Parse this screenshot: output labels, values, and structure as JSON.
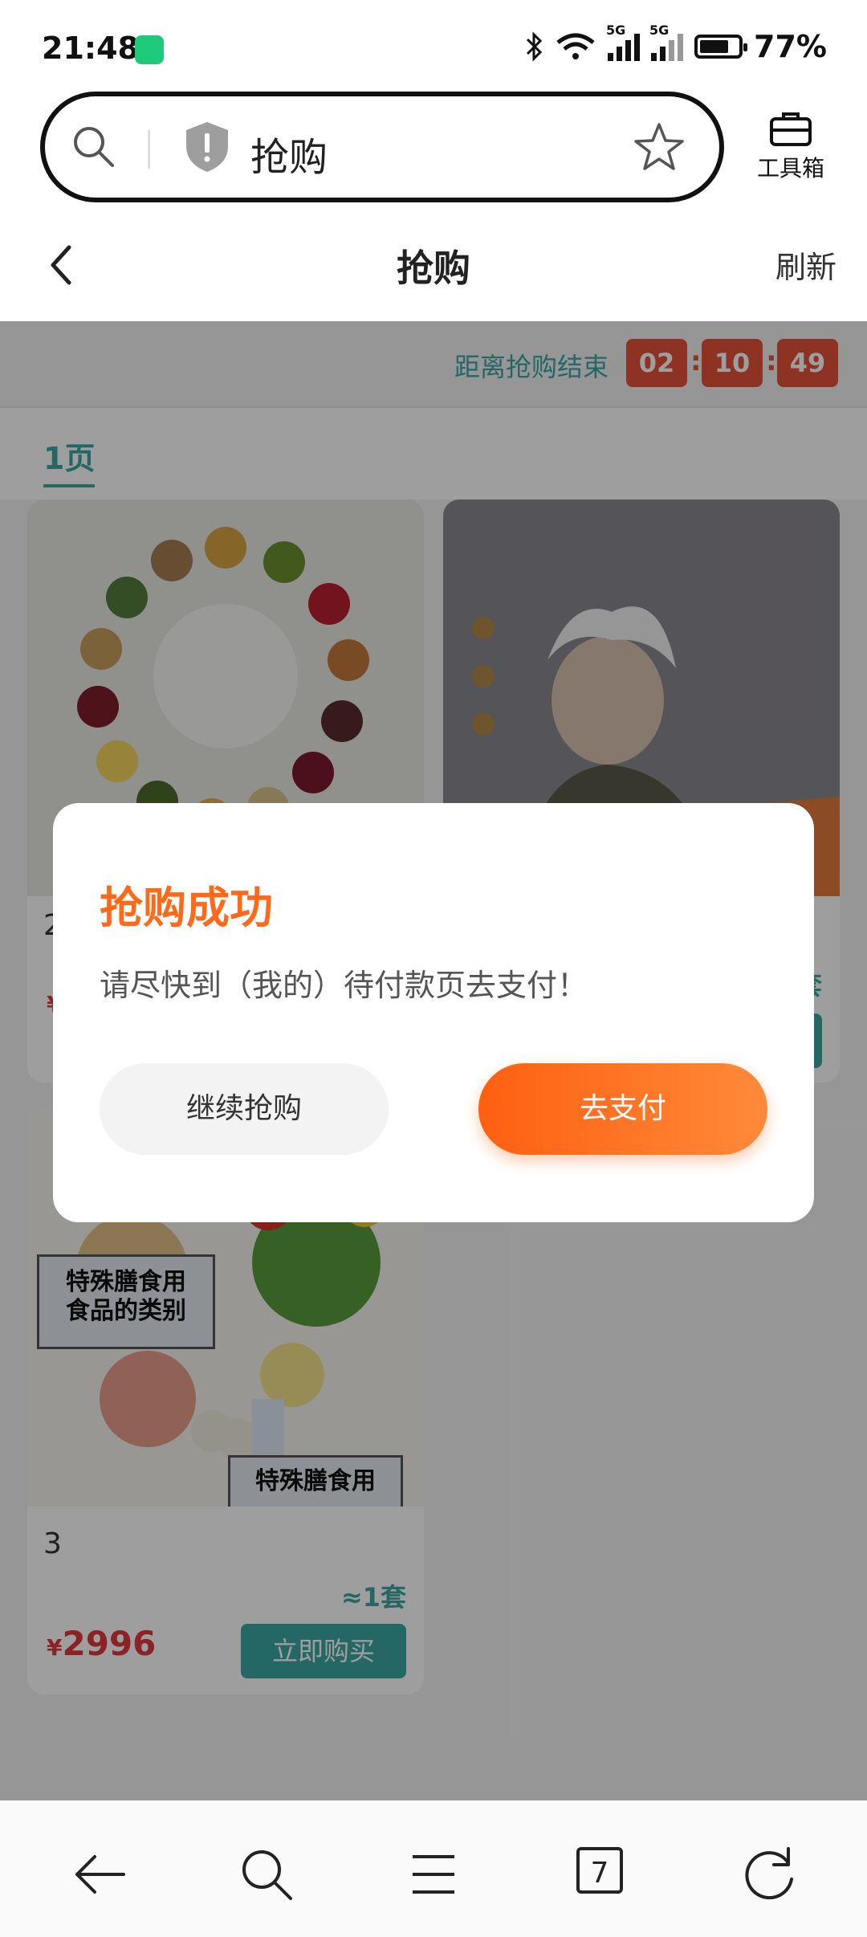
{
  "status_bar": {
    "time": "21:48",
    "battery": "77%",
    "battery_level": 0.77,
    "network_1": "5G",
    "network_2": "5G"
  },
  "url_bar": {
    "text": "抢购",
    "toolbox_label": "工具箱"
  },
  "header": {
    "title": "抢购",
    "refresh": "刷新"
  },
  "countdown": {
    "label": "距离抢购结束",
    "hours": "02",
    "minutes": "10",
    "seconds": "49",
    "separator": ":"
  },
  "tabs": [
    {
      "label": "1页"
    }
  ],
  "products": [
    {
      "number": "2",
      "price_symbol": "¥"
    },
    {
      "qty": "套"
    },
    {
      "number": "3",
      "qty": "≈1套",
      "price_symbol": "¥",
      "price": "2996",
      "buy_label": "立即购买",
      "image_texts": [
        "特殊膳食用",
        "食品的类别",
        "特殊膳食用"
      ]
    }
  ],
  "modal": {
    "title": "抢购成功",
    "message": "请尽快到（我的）待付款页去支付！",
    "continue_label": "继续抢购",
    "pay_label": "去支付"
  },
  "colors": {
    "accent": "#3aa6a4",
    "countdown": "#e5513a",
    "price": "#e0393e",
    "pay": "#ff6a1a"
  },
  "bottom_nav": {
    "tab_count": "7",
    "icons": [
      "back-arrow-icon",
      "search-icon",
      "menu-icon",
      "tabs-icon",
      "refresh-icon"
    ]
  }
}
